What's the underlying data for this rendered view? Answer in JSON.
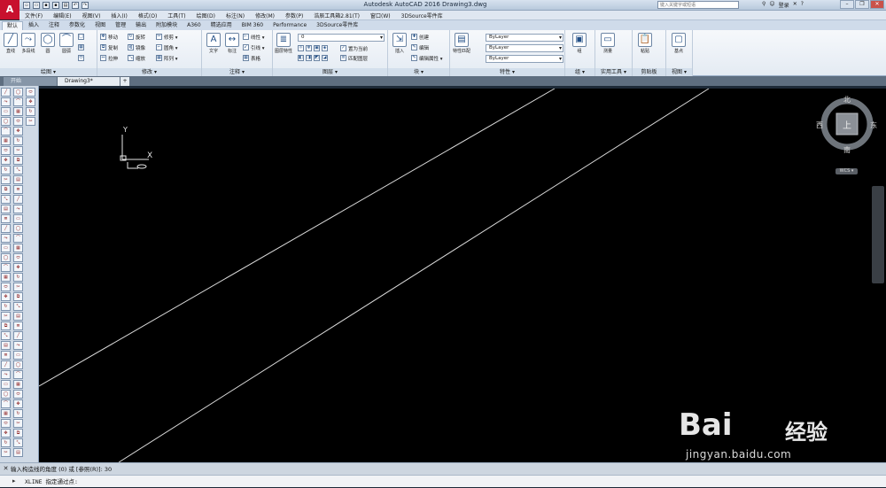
{
  "window": {
    "title": "Autodesk AutoCAD 2016    Drawing3.dwg",
    "logo": "A",
    "search_placeholder": "键入关键字或短语",
    "login_label": "登录",
    "controls": [
      "–",
      "❐",
      "✕"
    ]
  },
  "menubar": [
    "文件(F)",
    "编辑(E)",
    "视图(V)",
    "插入(I)",
    "格式(O)",
    "工具(T)",
    "绘图(D)",
    "标注(N)",
    "修改(M)",
    "参数(P)",
    "浩辰工具箱2.81(T)",
    "窗口(W)",
    "3DSource零件库"
  ],
  "ribbon_tabs": [
    "默认",
    "插入",
    "注释",
    "参数化",
    "视图",
    "管理",
    "输出",
    "附加模块",
    "A360",
    "精选应用",
    "BIM 360",
    "Performance",
    "3DSource零件库"
  ],
  "ribbon": {
    "draw": {
      "title": "绘图 ▾",
      "line": "直线",
      "polyline": "多段线",
      "circle": "圆",
      "arc": "圆弧"
    },
    "modify": {
      "title": "修改 ▾",
      "move": "移动",
      "rotate": "旋转",
      "trim": "修剪 ▾",
      "copy": "复制",
      "mirror": "镜像",
      "fillet": "圆角 ▾",
      "stretch": "拉伸",
      "scale": "缩放",
      "array": "阵列 ▾"
    },
    "annotation": {
      "title": "注释 ▾",
      "text": "文字",
      "dimension": "标注",
      "linear": "线性 ▾",
      "leader": "引线 ▾",
      "table": "表格"
    },
    "layers": {
      "title": "图层 ▾",
      "layer_props": "图层特性",
      "current_layer": "0",
      "set_current": "置为当前",
      "match_layer": "匹配图层"
    },
    "block": {
      "title": "块 ▾",
      "insert": "插入",
      "create": "创建",
      "edit": "编辑",
      "edit_attr": "编辑属性 ▾"
    },
    "properties": {
      "title": "特性 ▾",
      "match": "特性匹配",
      "color": "ByLayer",
      "linetype": "ByLayer",
      "lineweight": "ByLayer"
    },
    "groups": {
      "title": "组 ▾",
      "group": "组"
    },
    "utilities": {
      "title": "实用工具 ▾",
      "measure": "测量"
    },
    "clipboard": {
      "title": "剪贴板",
      "paste": "粘贴"
    },
    "view": {
      "title": "视图 ▾",
      "base": "基点"
    }
  },
  "document_tabs": [
    "开始",
    "Drawing3*",
    "+"
  ],
  "viewcube": {
    "north": "北",
    "south": "南",
    "east": "东",
    "west": "西",
    "face": "上",
    "wcs": "WCS ▾"
  },
  "ucs": {
    "y_label": "Y",
    "x_label": "X"
  },
  "command": {
    "history": "输入构造线的角度 (0) 或 [参照(R)]:  30",
    "prompt": "XLINE 指定通过点:"
  },
  "watermark": {
    "brand": "Bai",
    "brand2": "经验",
    "url": "jingyan.baidu.com"
  }
}
